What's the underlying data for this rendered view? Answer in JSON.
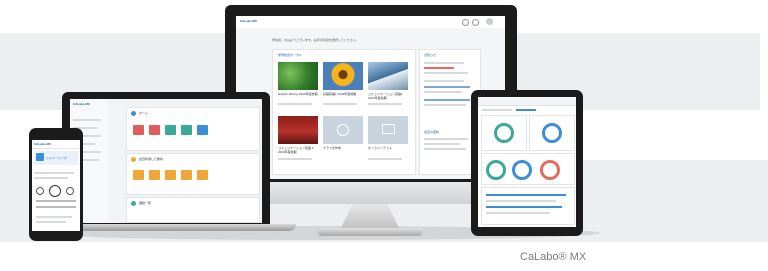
{
  "brand": {
    "name": "CaLabo® MX"
  },
  "colors": {
    "band": "#eceef0",
    "accent_orange": "#f0a73a",
    "accent_teal": "#3aa89b",
    "accent_blue": "#3b8fd9"
  },
  "imac": {
    "app_title": "CALabo MX",
    "greeting": "学生様、おはようございます。右手の科目を選択してください。",
    "courses_heading": "学習総合ポータル",
    "courses": [
      {
        "title": "English Writing 2020年度前期",
        "thumb": "green-leaves"
      },
      {
        "title": "基礎英語1 2020年度前期",
        "thumb": "sunflower"
      },
      {
        "title": "コミュニケーション英語1 2020年度前期",
        "thumb": "mountain"
      },
      {
        "title": "コミュニケーション英語 2 2020年度前期",
        "thumb": "red-room"
      },
      {
        "title": "クラスを作成",
        "thumb": "add-icon"
      },
      {
        "title": "オンラインテスト",
        "thumb": "monitor-icon"
      }
    ],
    "side_heading": "お知らせ",
    "side_second_heading": "最近の更新"
  },
  "laptop": {
    "app_title": "CALabo MX",
    "section1": "ホーム",
    "section2": "最近利用した教材",
    "section3": "課題一覧"
  },
  "phone": {
    "app_title": "CALabo MX",
    "track_title": "シャドーイング"
  }
}
